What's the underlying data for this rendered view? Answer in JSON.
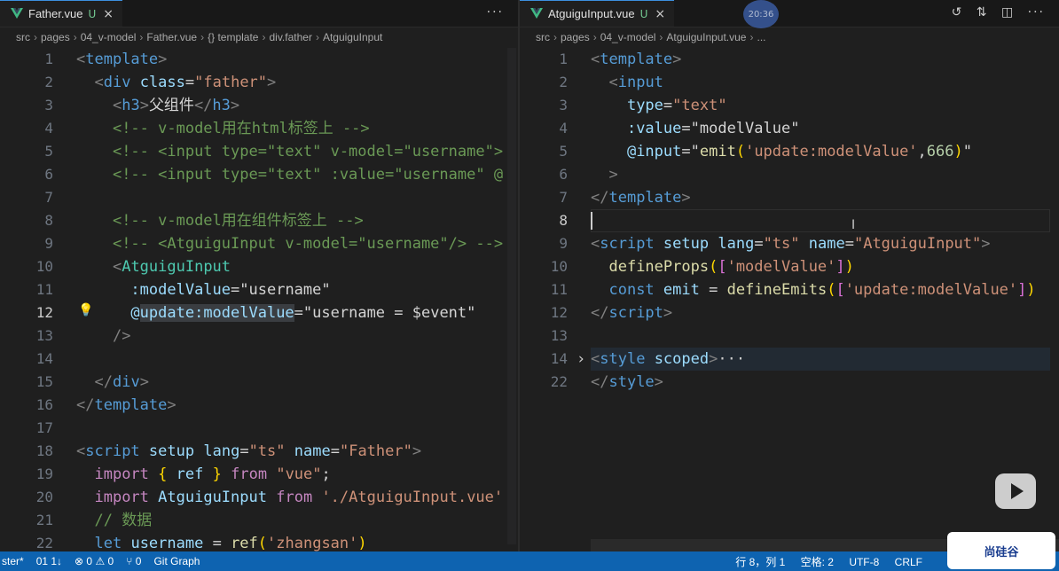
{
  "left": {
    "tab": {
      "title": "Father.vue",
      "status": "U",
      "close": "×"
    },
    "tab_actions": "···",
    "breadcrumb": [
      "src",
      "pages",
      "04_v-model",
      "Father.vue",
      "{} template",
      "div.father",
      "AtguiguInput"
    ],
    "active_line": 12,
    "lines": [
      {
        "n": "1",
        "segs": [
          [
            "t-tag",
            "<"
          ],
          [
            "t-name",
            "template"
          ],
          [
            "t-tag",
            ">"
          ]
        ]
      },
      {
        "n": "2",
        "segs": [
          [
            "t-plain",
            "  "
          ],
          [
            "t-tag",
            "<"
          ],
          [
            "t-name",
            "div"
          ],
          [
            "t-plain",
            " "
          ],
          [
            "t-attr",
            "class"
          ],
          [
            "t-plain",
            "="
          ],
          [
            "t-str",
            "\"father\""
          ],
          [
            "t-tag",
            ">"
          ]
        ]
      },
      {
        "n": "3",
        "segs": [
          [
            "t-plain",
            "    "
          ],
          [
            "t-tag",
            "<"
          ],
          [
            "t-name",
            "h3"
          ],
          [
            "t-tag",
            ">"
          ],
          [
            "t-plain",
            "父组件"
          ],
          [
            "t-tag",
            "</"
          ],
          [
            "t-name",
            "h3"
          ],
          [
            "t-tag",
            ">"
          ]
        ]
      },
      {
        "n": "4",
        "segs": [
          [
            "t-plain",
            "    "
          ],
          [
            "t-cmt",
            "<!-- v-model用在html标签上 -->"
          ]
        ]
      },
      {
        "n": "5",
        "segs": [
          [
            "t-plain",
            "    "
          ],
          [
            "t-cmt",
            "<!-- <input type=\"text\" v-model=\"username\">"
          ]
        ]
      },
      {
        "n": "6",
        "segs": [
          [
            "t-plain",
            "    "
          ],
          [
            "t-cmt",
            "<!-- <input type=\"text\" :value=\"username\" @"
          ]
        ]
      },
      {
        "n": "7",
        "segs": []
      },
      {
        "n": "8",
        "segs": [
          [
            "t-plain",
            "    "
          ],
          [
            "t-cmt",
            "<!-- v-model用在组件标签上 -->"
          ]
        ]
      },
      {
        "n": "9",
        "segs": [
          [
            "t-plain",
            "    "
          ],
          [
            "t-cmt",
            "<!-- <AtguiguInput v-model=\"username\"/> -->"
          ]
        ]
      },
      {
        "n": "10",
        "segs": [
          [
            "t-plain",
            "    "
          ],
          [
            "t-tag",
            "<"
          ],
          [
            "t-comp",
            "AtguiguInput"
          ]
        ]
      },
      {
        "n": "11",
        "segs": [
          [
            "t-plain",
            "      "
          ],
          [
            "t-attr",
            ":modelValue"
          ],
          [
            "t-plain",
            "="
          ],
          [
            "t-plain",
            "\"username\""
          ]
        ]
      },
      {
        "n": "12",
        "segs": [
          [
            "t-plain",
            "      "
          ],
          [
            "t-attr",
            "@"
          ],
          [
            "t-attr hl",
            "update:modelValue"
          ],
          [
            "t-plain",
            "="
          ],
          [
            "t-plain",
            "\"username = $event\""
          ]
        ]
      },
      {
        "n": "13",
        "segs": [
          [
            "t-plain",
            "    "
          ],
          [
            "t-tag",
            "/>"
          ]
        ]
      },
      {
        "n": "14",
        "segs": []
      },
      {
        "n": "15",
        "segs": [
          [
            "t-plain",
            "  "
          ],
          [
            "t-tag",
            "</"
          ],
          [
            "t-name",
            "div"
          ],
          [
            "t-tag",
            ">"
          ]
        ]
      },
      {
        "n": "16",
        "segs": [
          [
            "t-tag",
            "</"
          ],
          [
            "t-name",
            "template"
          ],
          [
            "t-tag",
            ">"
          ]
        ]
      },
      {
        "n": "17",
        "segs": []
      },
      {
        "n": "18",
        "segs": [
          [
            "t-tag",
            "<"
          ],
          [
            "t-name",
            "script"
          ],
          [
            "t-plain",
            " "
          ],
          [
            "t-attr",
            "setup"
          ],
          [
            "t-plain",
            " "
          ],
          [
            "t-attr",
            "lang"
          ],
          [
            "t-plain",
            "="
          ],
          [
            "t-str",
            "\"ts\""
          ],
          [
            "t-plain",
            " "
          ],
          [
            "t-attr",
            "name"
          ],
          [
            "t-plain",
            "="
          ],
          [
            "t-str",
            "\"Father\""
          ],
          [
            "t-tag",
            ">"
          ]
        ]
      },
      {
        "n": "19",
        "segs": [
          [
            "t-plain",
            "  "
          ],
          [
            "t-kw",
            "import"
          ],
          [
            "t-plain",
            " "
          ],
          [
            "t-br",
            "{"
          ],
          [
            "t-plain",
            " "
          ],
          [
            "t-var",
            "ref"
          ],
          [
            "t-plain",
            " "
          ],
          [
            "t-br",
            "}"
          ],
          [
            "t-plain",
            " "
          ],
          [
            "t-kw",
            "from"
          ],
          [
            "t-plain",
            " "
          ],
          [
            "t-str",
            "\"vue\""
          ],
          [
            "t-plain",
            ";"
          ]
        ]
      },
      {
        "n": "20",
        "segs": [
          [
            "t-plain",
            "  "
          ],
          [
            "t-kw",
            "import"
          ],
          [
            "t-plain",
            " "
          ],
          [
            "t-var",
            "AtguiguInput"
          ],
          [
            "t-plain",
            " "
          ],
          [
            "t-kw",
            "from"
          ],
          [
            "t-plain",
            " "
          ],
          [
            "t-str",
            "'./AtguiguInput.vue'"
          ]
        ]
      },
      {
        "n": "21",
        "segs": [
          [
            "t-plain",
            "  "
          ],
          [
            "t-cmt",
            "// 数据"
          ]
        ]
      },
      {
        "n": "22",
        "segs": [
          [
            "t-plain",
            "  "
          ],
          [
            "t-name",
            "let"
          ],
          [
            "t-plain",
            " "
          ],
          [
            "t-var",
            "username"
          ],
          [
            "t-plain",
            " = "
          ],
          [
            "t-fn",
            "ref"
          ],
          [
            "t-br",
            "("
          ],
          [
            "t-str",
            "'zhangsan'"
          ],
          [
            "t-br",
            ")"
          ]
        ]
      }
    ]
  },
  "right": {
    "tab": {
      "title": "AtguiguInput.vue",
      "status": "U",
      "close": "×"
    },
    "tab_actions": [
      "↺",
      "⇅",
      "◫",
      "···"
    ],
    "breadcrumb": [
      "src",
      "pages",
      "04_v-model",
      "AtguiguInput.vue",
      "..."
    ],
    "active_line": 8,
    "lines": [
      {
        "n": "1",
        "segs": [
          [
            "t-tag",
            "<"
          ],
          [
            "t-name",
            "template"
          ],
          [
            "t-tag",
            ">"
          ]
        ]
      },
      {
        "n": "2",
        "segs": [
          [
            "t-plain",
            "  "
          ],
          [
            "t-tag",
            "<"
          ],
          [
            "t-name",
            "input"
          ]
        ]
      },
      {
        "n": "3",
        "segs": [
          [
            "t-plain",
            "    "
          ],
          [
            "t-attr",
            "type"
          ],
          [
            "t-plain",
            "="
          ],
          [
            "t-str",
            "\"text\""
          ]
        ]
      },
      {
        "n": "4",
        "segs": [
          [
            "t-plain",
            "    "
          ],
          [
            "t-attr",
            ":value"
          ],
          [
            "t-plain",
            "="
          ],
          [
            "t-plain",
            "\"modelValue\""
          ]
        ]
      },
      {
        "n": "5",
        "segs": [
          [
            "t-plain",
            "    "
          ],
          [
            "t-attr",
            "@input"
          ],
          [
            "t-plain",
            "="
          ],
          [
            "t-plain",
            "\""
          ],
          [
            "t-fn",
            "emit"
          ],
          [
            "t-br",
            "("
          ],
          [
            "t-str",
            "'update:modelValue'"
          ],
          [
            "t-plain",
            ","
          ],
          [
            "t-num",
            "666"
          ],
          [
            "t-br",
            ")"
          ],
          [
            "t-plain",
            "\""
          ]
        ]
      },
      {
        "n": "6",
        "segs": [
          [
            "t-plain",
            "  "
          ],
          [
            "t-tag",
            ">"
          ]
        ]
      },
      {
        "n": "7",
        "segs": [
          [
            "t-tag",
            "</"
          ],
          [
            "t-name",
            "template"
          ],
          [
            "t-tag",
            ">"
          ]
        ]
      },
      {
        "n": "8",
        "segs": []
      },
      {
        "n": "9",
        "segs": [
          [
            "t-tag",
            "<"
          ],
          [
            "t-name",
            "script"
          ],
          [
            "t-plain",
            " "
          ],
          [
            "t-attr",
            "setup"
          ],
          [
            "t-plain",
            " "
          ],
          [
            "t-attr",
            "lang"
          ],
          [
            "t-plain",
            "="
          ],
          [
            "t-str",
            "\"ts\""
          ],
          [
            "t-plain",
            " "
          ],
          [
            "t-attr",
            "name"
          ],
          [
            "t-plain",
            "="
          ],
          [
            "t-str",
            "\"AtguiguInput\""
          ],
          [
            "t-tag",
            ">"
          ]
        ]
      },
      {
        "n": "10",
        "segs": [
          [
            "t-plain",
            "  "
          ],
          [
            "t-fn",
            "defineProps"
          ],
          [
            "t-br",
            "("
          ],
          [
            "t-br2",
            "["
          ],
          [
            "t-str",
            "'modelValue'"
          ],
          [
            "t-br2",
            "]"
          ],
          [
            "t-br",
            ")"
          ]
        ]
      },
      {
        "n": "11",
        "segs": [
          [
            "t-plain",
            "  "
          ],
          [
            "t-name",
            "const"
          ],
          [
            "t-plain",
            " "
          ],
          [
            "t-var",
            "emit"
          ],
          [
            "t-plain",
            " = "
          ],
          [
            "t-fn",
            "defineEmits"
          ],
          [
            "t-br",
            "("
          ],
          [
            "t-br2",
            "["
          ],
          [
            "t-str",
            "'update:modelValue'"
          ],
          [
            "t-br2",
            "]"
          ],
          [
            "t-br",
            ")"
          ]
        ]
      },
      {
        "n": "12",
        "segs": [
          [
            "t-tag",
            "</"
          ],
          [
            "t-name",
            "script"
          ],
          [
            "t-tag",
            ">"
          ]
        ]
      },
      {
        "n": "13",
        "segs": []
      },
      {
        "n": "14",
        "segs": [
          [
            "t-tag",
            "<"
          ],
          [
            "t-name",
            "style"
          ],
          [
            "t-plain",
            " "
          ],
          [
            "t-attr",
            "scoped"
          ],
          [
            "t-tag",
            ">"
          ],
          [
            "t-fold",
            "···"
          ]
        ]
      },
      {
        "n": "22",
        "segs": [
          [
            "t-tag",
            "</"
          ],
          [
            "t-name",
            "style"
          ],
          [
            "t-tag",
            ">"
          ]
        ]
      }
    ]
  },
  "timestamp_badge": "20:36",
  "status_bar": {
    "branch": "ster*",
    "sync": "01 1↓",
    "problems": "⊗ 0 ⚠ 0",
    "ports": "⑂ 0",
    "git_graph": "Git Graph",
    "position": "行 8，列 1",
    "spaces": "空格: 2",
    "encoding": "UTF-8",
    "eol": "CRLF"
  },
  "watermark_logo": "尚硅谷"
}
